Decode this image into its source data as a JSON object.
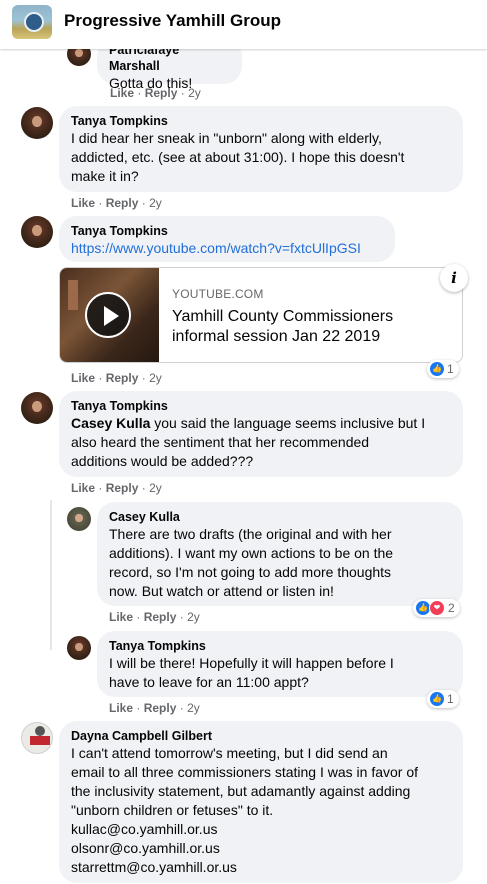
{
  "header": {
    "group_name": "Progressive Yamhill Group"
  },
  "actions": {
    "like": "Like",
    "reply": "Reply",
    "sep": "·",
    "age": "2y"
  },
  "comments": [
    {
      "author": "Patriciafaye Marshall",
      "lines": [
        "Gotta do this!"
      ]
    },
    {
      "author": "Tanya Tompkins",
      "lines": [
        "I did hear her sneak in \"unborn\" along with elderly,",
        "addicted, etc. (see at about 31:00). I hope this doesn't",
        "make it in?"
      ]
    },
    {
      "author": "Tanya Tompkins",
      "link": "https://www.youtube.com/watch?v=fxtcUlIpGSI",
      "card": {
        "domain": "YOUTUBE.COM",
        "title_line1": "Yamhill County Commissioners",
        "title_line2": "informal session Jan 22 2019"
      },
      "reaction_count": "1"
    },
    {
      "author": "Tanya Tompkins",
      "mention": "Casey Kulla",
      "lines": [
        " you said the language seems inclusive but I",
        "also heard the sentiment that her recommended",
        "additions would be added???"
      ]
    },
    {
      "author": "Casey Kulla",
      "lines": [
        "There are two drafts (the original and with her",
        "additions). I want my own actions to be on the",
        "record, so I'm not going to add more thoughts",
        "now. But watch or attend or listen in!"
      ],
      "reaction_count": "2"
    },
    {
      "author": "Tanya Tompkins",
      "lines": [
        "I will be there! Hopefully it will happen before I",
        "have to leave for an 11:00 appt?"
      ],
      "reaction_count": "1"
    },
    {
      "author": "Dayna Campbell Gilbert",
      "lines": [
        "I can't attend tomorrow's meeting, but I did send an",
        "email to all three commissioners stating I was in favor of",
        "the inclusivity statement, but adamantly against adding",
        "\"unborn children or fetuses\" to it.",
        "kullac@co.yamhill.or.us",
        "olsonr@co.yamhill.or.us",
        "starrettm@co.yamhill.or.us"
      ]
    }
  ]
}
